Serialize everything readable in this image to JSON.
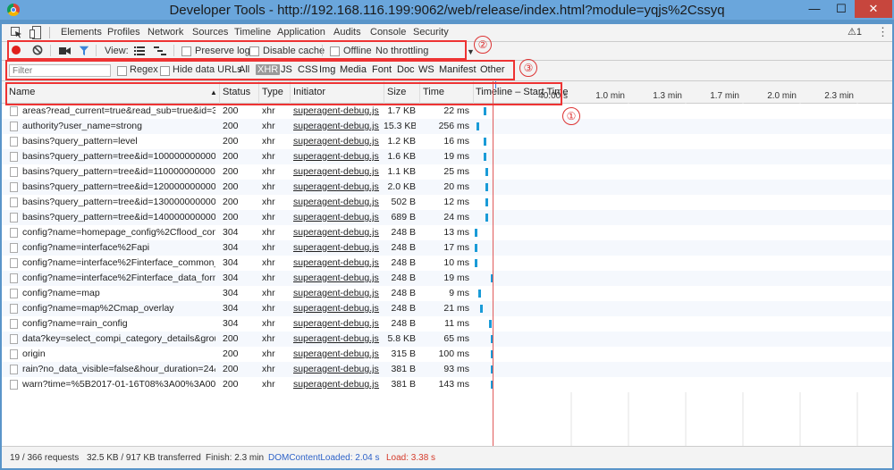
{
  "window": {
    "title": "Developer Tools - http://192.168.116.199:9062/web/release/index.html?module=yqjs%2Cssyq",
    "min_icon": "minimize-icon",
    "max_icon": "maximize-icon",
    "close_icon": "close-icon",
    "min_glyph": "—",
    "max_glyph": "☐",
    "close_glyph": "✕"
  },
  "tabs": [
    "Elements",
    "Profiles",
    "Network",
    "Sources",
    "Timeline",
    "Application",
    "Audits",
    "Console",
    "Security"
  ],
  "warnings": "⚠1",
  "toolbar": {
    "view_label": "View:",
    "preserve_log": "Preserve log",
    "disable_cache": "Disable cache",
    "offline": "Offline",
    "throttling": "No throttling"
  },
  "filterbar": {
    "placeholder": "Filter",
    "regex": "Regex",
    "hide_data_urls": "Hide data URLs",
    "types": [
      "All",
      "XHR",
      "JS",
      "CSS",
      "Img",
      "Media",
      "Font",
      "Doc",
      "WS",
      "Manifest",
      "Other"
    ],
    "active_type": "XHR"
  },
  "columns": {
    "name": "Name",
    "sort_glyph": "▲",
    "status": "Status",
    "type": "Type",
    "initiator": "Initiator",
    "size": "Size",
    "time": "Time",
    "timeline": "Timeline – Start Time"
  },
  "chart_data": {
    "type": "bar",
    "xlabel": "Timeline – Start Time",
    "ticks": [
      "40.00 s",
      "1.0 min",
      "1.3 min",
      "1.7 min",
      "2.0 min",
      "2.3 min"
    ],
    "marker_labels": {
      "domcontentloaded": "DOMContentLoaded: 2.04 s",
      "load": "Load: 3.38 s"
    }
  },
  "rows": [
    {
      "name": "areas?read_current=true&read_sub=true&id=35...",
      "status": "200",
      "type": "xhr",
      "initiator": "superagent-debug.js...",
      "size": "1.7 KB",
      "time": "22 ms",
      "start": 0.12,
      "dur": 0.03
    },
    {
      "name": "authority?user_name=strong",
      "status": "200",
      "type": "xhr",
      "initiator": "superagent-debug.js...",
      "size": "15.3 KB",
      "time": "256 ms",
      "start": 0.04,
      "dur": 0.03
    },
    {
      "name": "basins?query_pattern=level",
      "status": "200",
      "type": "xhr",
      "initiator": "superagent-debug.js...",
      "size": "1.2 KB",
      "time": "16 ms",
      "start": 0.12,
      "dur": 0.03
    },
    {
      "name": "basins?query_pattern=tree&id=100000000000",
      "status": "200",
      "type": "xhr",
      "initiator": "superagent-debug.js...",
      "size": "1.6 KB",
      "time": "19 ms",
      "start": 0.12,
      "dur": 0.03
    },
    {
      "name": "basins?query_pattern=tree&id=110000000000",
      "status": "200",
      "type": "xhr",
      "initiator": "superagent-debug.js...",
      "size": "1.1 KB",
      "time": "25 ms",
      "start": 0.14,
      "dur": 0.03
    },
    {
      "name": "basins?query_pattern=tree&id=120000000000",
      "status": "200",
      "type": "xhr",
      "initiator": "superagent-debug.js...",
      "size": "2.0 KB",
      "time": "20 ms",
      "start": 0.14,
      "dur": 0.03
    },
    {
      "name": "basins?query_pattern=tree&id=130000000000",
      "status": "200",
      "type": "xhr",
      "initiator": "superagent-debug.js...",
      "size": "502 B",
      "time": "12 ms",
      "start": 0.14,
      "dur": 0.03
    },
    {
      "name": "basins?query_pattern=tree&id=140000000000",
      "status": "200",
      "type": "xhr",
      "initiator": "superagent-debug.js...",
      "size": "689 B",
      "time": "24 ms",
      "start": 0.14,
      "dur": 0.03
    },
    {
      "name": "config?name=homepage_config%2Cflood_contr...",
      "status": "304",
      "type": "xhr",
      "initiator": "superagent-debug.js...",
      "size": "248 B",
      "time": "13 ms",
      "start": 0.02,
      "dur": 0.03
    },
    {
      "name": "config?name=interface%2Fapi",
      "status": "304",
      "type": "xhr",
      "initiator": "superagent-debug.js...",
      "size": "248 B",
      "time": "17 ms",
      "start": 0.02,
      "dur": 0.03
    },
    {
      "name": "config?name=interface%2Finterface_common_m...",
      "status": "304",
      "type": "xhr",
      "initiator": "superagent-debug.js...",
      "size": "248 B",
      "time": "10 ms",
      "start": 0.02,
      "dur": 0.03
    },
    {
      "name": "config?name=interface%2Finterface_data_format",
      "status": "304",
      "type": "xhr",
      "initiator": "superagent-debug.js...",
      "size": "248 B",
      "time": "19 ms",
      "start": 0.2,
      "dur": 0.03
    },
    {
      "name": "config?name=map",
      "status": "304",
      "type": "xhr",
      "initiator": "superagent-debug.js...",
      "size": "248 B",
      "time": "9 ms",
      "start": 0.06,
      "dur": 0.03
    },
    {
      "name": "config?name=map%2Cmap_overlay",
      "status": "304",
      "type": "xhr",
      "initiator": "superagent-debug.js...",
      "size": "248 B",
      "time": "21 ms",
      "start": 0.08,
      "dur": 0.03
    },
    {
      "name": "config?name=rain_config",
      "status": "304",
      "type": "xhr",
      "initiator": "superagent-debug.js...",
      "size": "248 B",
      "time": "11 ms",
      "start": 0.18,
      "dur": 0.03
    },
    {
      "name": "data?key=select_compi_category_details&grou...",
      "status": "200",
      "type": "xhr",
      "initiator": "superagent-debug.js...",
      "size": "5.8 KB",
      "time": "65 ms",
      "start": 0.2,
      "dur": 0.03
    },
    {
      "name": "origin",
      "status": "200",
      "type": "xhr",
      "initiator": "superagent-debug.js...",
      "size": "315 B",
      "time": "100 ms",
      "start": 0.2,
      "dur": 0.03
    },
    {
      "name": "rain?no_data_visible=false&hour_duration=24&t...",
      "status": "200",
      "type": "xhr",
      "initiator": "superagent-debug.js...",
      "size": "381 B",
      "time": "93 ms",
      "start": 0.2,
      "dur": 0.03
    },
    {
      "name": "warn?time=%5B2017-01-16T08%3A00%3A00%2...",
      "status": "200",
      "type": "xhr",
      "initiator": "superagent-debug.js...",
      "size": "381 B",
      "time": "143 ms",
      "start": 0.2,
      "dur": 0.03
    }
  ],
  "status": {
    "requests": "19 / 366 requests",
    "transferred": "32.5 KB / 917 KB transferred",
    "finish": "Finish: 2.3 min",
    "domcontentloaded": "DOMContentLoaded: 2.04 s",
    "load": "Load: 3.38 s"
  },
  "callouts": [
    "①",
    "②",
    "③"
  ],
  "colors": {
    "bar": "#1a9bd7",
    "load_line": "#e05a5a",
    "dcl": "#3b7de0",
    "highlight": "#e33333"
  }
}
